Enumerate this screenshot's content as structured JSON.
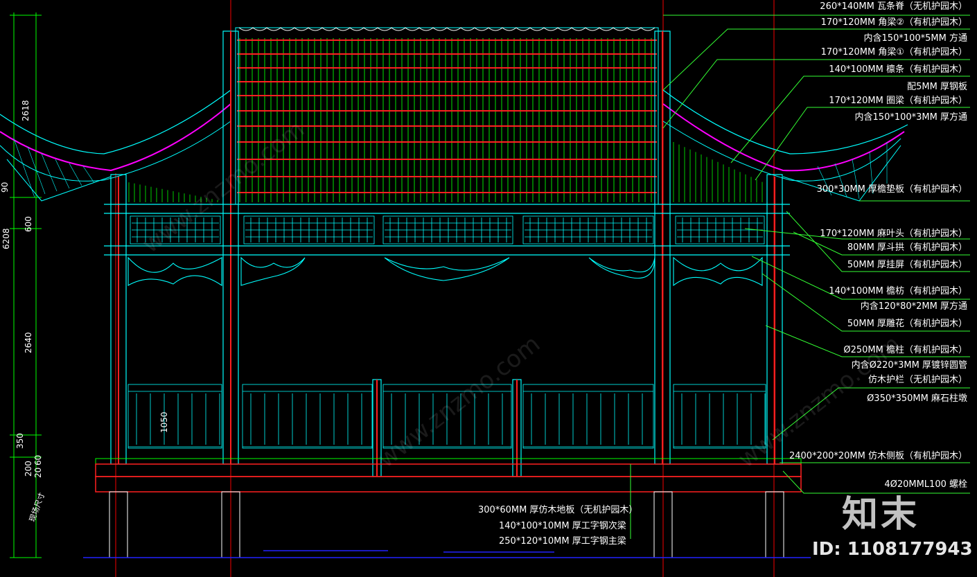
{
  "annotations_right": [
    "260*140MM 瓦条脊（无机护园木）",
    "170*120MM 角梁②（有机护园木）",
    "内含150*100*5MM 方通",
    "170*120MM 角梁①（有机护园木）",
    "140*100MM 檩条（有机护园木）",
    "配5MM 厚钢板",
    "170*120MM 圈梁（有机护园木）",
    "内含150*100*3MM 厚方通",
    "300*30MM 厚檐垫板（有机护园木）",
    "170*120MM 麻叶头（有机护园木）",
    "80MM 厚斗拱（有机护园木）",
    "50MM 厚挂屏（有机护园木）",
    "140*100MM 檐枋（有机护园木）",
    "内含120*80*2MM 厚方通",
    "50MM 厚雕花（有机护园木）",
    "Ø250MM 檐柱（有机护园木）",
    "内含Ø220*3MM 厚镀锌圆管",
    "仿木护栏（无机护园木）",
    "Ø350*350MM 麻石柱墩",
    "2400*200*20MM 仿木侧板（有机护园木）",
    "4Ø20MML100 螺栓"
  ],
  "annotations_bottom": [
    "300*60MM 厚仿木地板（无机护园木）",
    "140*100*10MM 厚工字钢次梁",
    "250*120*10MM 厚工字钢主梁"
  ],
  "dimensions_left": [
    "2618",
    "90",
    "600",
    "6208",
    "2640",
    "350",
    "200",
    "60",
    "20"
  ],
  "dimension_inner": "1050",
  "stamp_text": "现场尺寸",
  "watermark": {
    "logo": "知末",
    "id": "ID: 1108177943",
    "site": "www.znzmo.com"
  },
  "colors": {
    "background": "#000000",
    "structure_cyan": "#00ffff",
    "rafter_green": "#00ff00",
    "beam_red": "#ff2020",
    "roof_magenta": "#ff00ff",
    "leader_green": "#33ff33",
    "guide_red": "#cc0000",
    "ground_blue": "#2222ff",
    "hatch_white": "#ffffff"
  }
}
